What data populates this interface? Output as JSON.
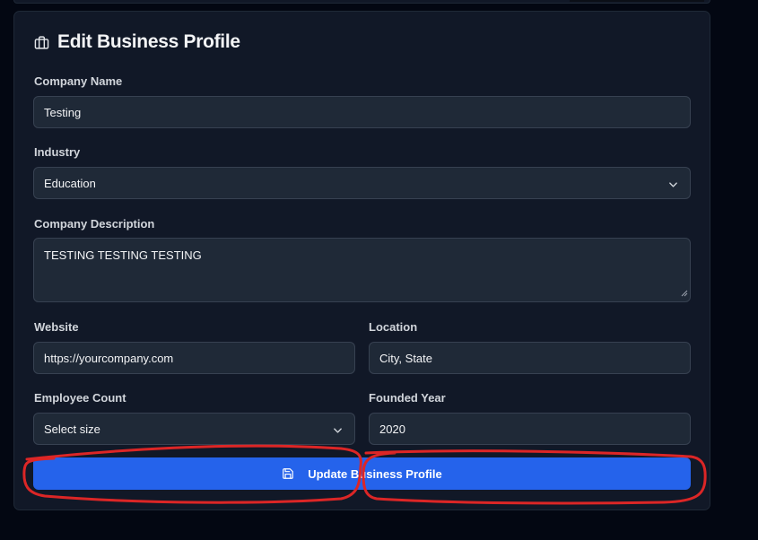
{
  "form": {
    "title": "Edit Business Profile",
    "icon": "briefcase-icon",
    "company_name": {
      "label": "Company Name",
      "value": "Testing"
    },
    "industry": {
      "label": "Industry",
      "value": "Education"
    },
    "description": {
      "label": "Company Description",
      "value": "TESTING TESTING TESTING"
    },
    "website": {
      "label": "Website",
      "value": "https://yourcompany.com"
    },
    "location": {
      "label": "Location",
      "value": "City, State"
    },
    "employee_count": {
      "label": "Employee Count",
      "value": "Select size"
    },
    "founded_year": {
      "label": "Founded Year",
      "value": "2020"
    },
    "submit_label": "Update Business Profile",
    "submit_icon": "save-icon"
  },
  "colors": {
    "page_bg": "#030712",
    "card_bg": "#111827",
    "input_bg": "#1f2937",
    "input_border": "#374151",
    "button": "#2563eb",
    "annotation": "#dc2626"
  }
}
